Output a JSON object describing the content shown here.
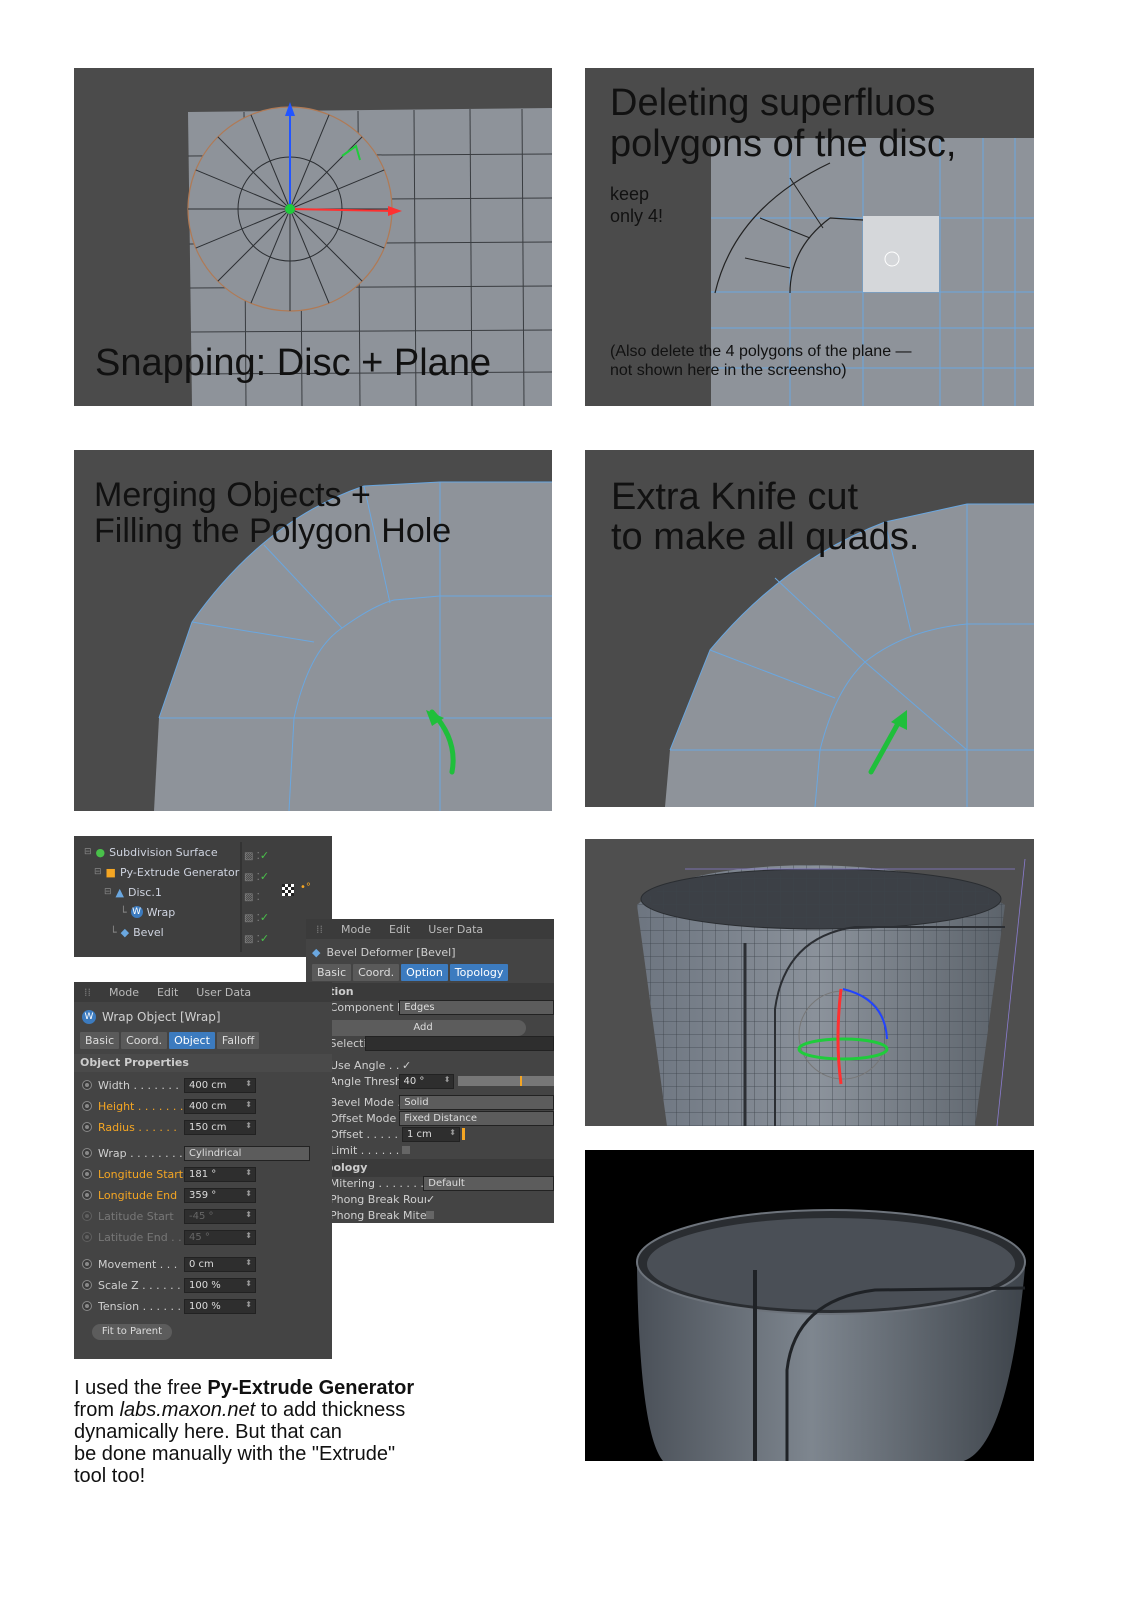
{
  "panels": {
    "p1": {
      "caption": "Snapping: Disc + Plane"
    },
    "p2": {
      "caption_line1": "Deleting superfluos",
      "caption_line2": "polygons of the disc,",
      "sub_line1": "keep",
      "sub_line2": "only 4!",
      "note_line1": "(Also delete the 4 polygons of the plane —",
      "note_line2": "not shown here in the screensho)"
    },
    "p3": {
      "caption_line1": "Merging Objects +",
      "caption_line2": "Filling the Polygon Hole"
    },
    "p4": {
      "caption_line1": "Extra Knife cut",
      "caption_line2": "to make all quads."
    }
  },
  "object_tree": {
    "items": [
      {
        "label": "Subdivision Surface",
        "icon": "subdivision-icon"
      },
      {
        "label": "Py-Extrude Generator",
        "icon": "cube-icon"
      },
      {
        "label": "Disc.1",
        "icon": "disc-icon"
      },
      {
        "label": "Wrap",
        "icon": "wrap-icon"
      },
      {
        "label": "Bevel",
        "icon": "bevel-icon"
      }
    ]
  },
  "wrap_panel": {
    "menu": [
      "Mode",
      "Edit",
      "User Data"
    ],
    "title": "Wrap Object [Wrap]",
    "tabs": [
      "Basic",
      "Coord.",
      "Object",
      "Falloff"
    ],
    "active_tab": "Object",
    "section": "Object Properties",
    "width": {
      "label": "Width . . . . . . .",
      "value": "400 cm"
    },
    "height": {
      "label": "Height . . . . . . .",
      "value": "400 cm"
    },
    "radius": {
      "label": "Radius . . . . . .",
      "value": "150 cm"
    },
    "wrap": {
      "label": "Wrap . . . . . . . .",
      "value": "Cylindrical"
    },
    "lon_start": {
      "label": "Longitude Start",
      "value": "181 °"
    },
    "lon_end": {
      "label": "Longitude End",
      "value": "359 °"
    },
    "lat_start": {
      "label": "Latitude Start",
      "value": "-45 °"
    },
    "lat_end": {
      "label": "Latitude End . .",
      "value": "45 °"
    },
    "movement": {
      "label": "Movement . . .",
      "value": "0 cm"
    },
    "scalez": {
      "label": "Scale Z . . . . . .",
      "value": "100 %"
    },
    "tension": {
      "label": "Tension . . . . . .",
      "value": "100 %"
    },
    "fit_button": "Fit to Parent"
  },
  "bevel_panel": {
    "menu": [
      "Mode",
      "Edit",
      "User Data"
    ],
    "title": "Bevel Deformer [Bevel]",
    "tabs": [
      "Basic",
      "Coord.",
      "Option",
      "Topology"
    ],
    "section_option": "Option",
    "component_mode": {
      "label": "Component Mode",
      "value": "Edges"
    },
    "add_button": "Add",
    "selection_label": "Selection",
    "use_angle": {
      "label": "Use Angle . . . . .",
      "value": "✓"
    },
    "angle_threshold": {
      "label": "Angle Threshold",
      "value": "40 °"
    },
    "bevel_mode": {
      "label": "Bevel Mode . . .",
      "value": "Solid"
    },
    "offset_mode": {
      "label": "Offset Mode . . .",
      "value": "Fixed Distance"
    },
    "offset": {
      "label": "Offset . . . . . . . .",
      "value": "1 cm"
    },
    "limit": {
      "label": "Limit . . . . . . . . ."
    },
    "section_topology": "Topology",
    "mitering": {
      "label": "Mitering . . . . . . . . . . .",
      "value": "Default"
    },
    "phong_rounding": {
      "label": "Phong Break Rounding",
      "value": "✓"
    },
    "phong_miters": {
      "label": "Phong Break Miters . . ."
    }
  },
  "footer": {
    "t1": "I used the free ",
    "t1_bold": "Py-Extrude Generator",
    "t2a": "from ",
    "t2_italic": "labs.maxon.net",
    "t2b": " to add thickness",
    "t3": "dynamically here. But that can",
    "t4": "be done manually with the \"Extrude\"",
    "t5": "tool too!"
  },
  "colors": {
    "mesh_wire": "#6aa7e0",
    "accent_orange": "#f5a623",
    "green_arrow": "#1fbf3b"
  }
}
